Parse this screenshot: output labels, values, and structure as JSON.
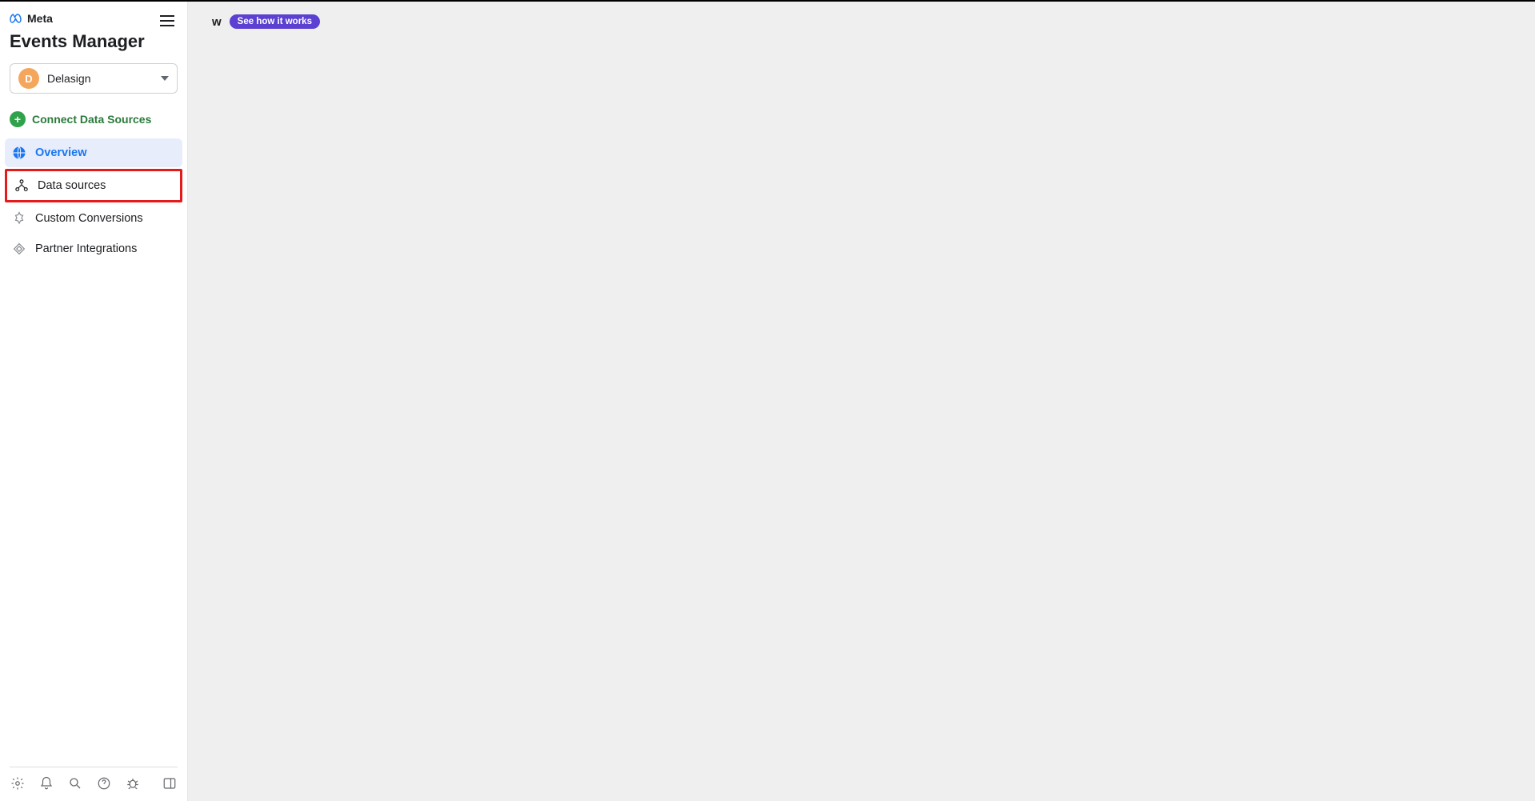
{
  "brand": "Meta",
  "page_title": "Events Manager",
  "account": {
    "avatar_letter": "D",
    "name": "Delasign"
  },
  "connect": {
    "label": "Connect Data Sources"
  },
  "nav": {
    "overview": "Overview",
    "data_sources": "Data sources",
    "custom_conversions": "Custom Conversions",
    "partner_integrations": "Partner Integrations"
  },
  "main": {
    "partial_letter": "w",
    "pill_label": "See how it works"
  }
}
